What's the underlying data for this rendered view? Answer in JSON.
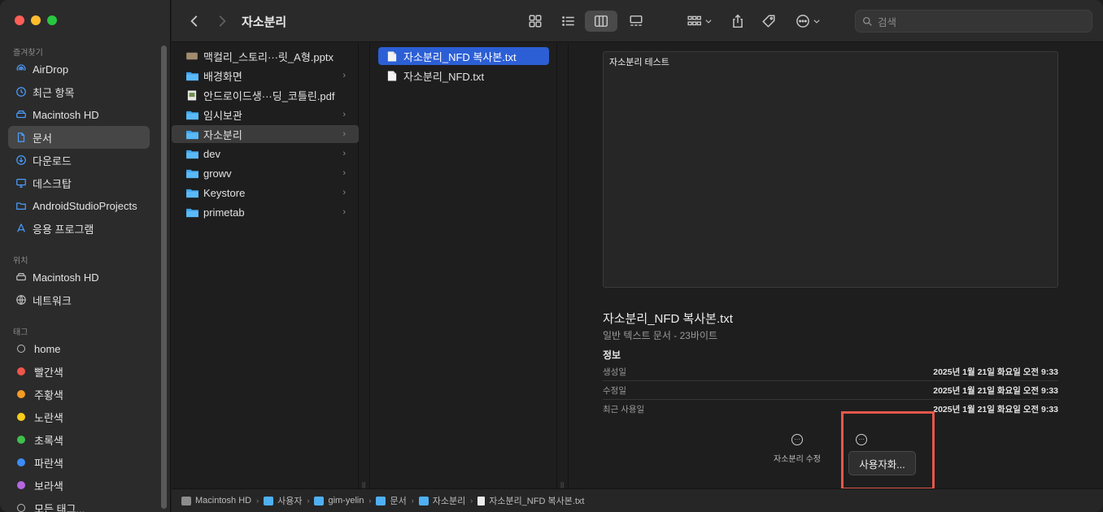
{
  "toolbar": {
    "title": "자소분리",
    "search_placeholder": "검색"
  },
  "sidebar": {
    "favorites_header": "즐겨찾기",
    "favorites": [
      {
        "label": "AirDrop",
        "icon": "airdrop-icon"
      },
      {
        "label": "최근 항목",
        "icon": "clock-icon"
      },
      {
        "label": "Macintosh HD",
        "icon": "hard-drive-icon"
      },
      {
        "label": "문서",
        "icon": "document-icon",
        "selected": true
      },
      {
        "label": "다운로드",
        "icon": "download-icon"
      },
      {
        "label": "데스크탑",
        "icon": "desktop-icon"
      },
      {
        "label": "AndroidStudioProjects",
        "icon": "folder-icon"
      },
      {
        "label": "응용 프로그램",
        "icon": "applications-icon"
      }
    ],
    "locations_header": "위치",
    "locations": [
      {
        "label": "Macintosh HD",
        "icon": "hard-drive-icon"
      },
      {
        "label": "네트워크",
        "icon": "network-icon"
      }
    ],
    "tags_header": "태그",
    "tags": [
      {
        "label": "home",
        "color": "none"
      },
      {
        "label": "빨간색",
        "color": "#f0564b"
      },
      {
        "label": "주황색",
        "color": "#f59b23"
      },
      {
        "label": "노란색",
        "color": "#f6cd1b"
      },
      {
        "label": "초록색",
        "color": "#3fc04b"
      },
      {
        "label": "파란색",
        "color": "#3b8df5"
      },
      {
        "label": "보라색",
        "color": "#b567e0"
      },
      {
        "label": "모든 태그...",
        "color": "none"
      }
    ]
  },
  "column1": [
    {
      "name": "맥컬리_스토리···릿_A형.pptx",
      "type": "pptx",
      "has_children": false
    },
    {
      "name": "배경화면",
      "type": "folder",
      "has_children": true
    },
    {
      "name": "안드로이드생···딩_코틀린.pdf",
      "type": "pdf",
      "has_children": false
    },
    {
      "name": "임시보관",
      "type": "folder",
      "has_children": true
    },
    {
      "name": "자소분리",
      "type": "folder",
      "has_children": true,
      "selected": true
    },
    {
      "name": "dev",
      "type": "folder",
      "has_children": true
    },
    {
      "name": "growv",
      "type": "folder",
      "has_children": true
    },
    {
      "name": "Keystore",
      "type": "folder",
      "has_children": true
    },
    {
      "name": "primetab",
      "type": "folder",
      "has_children": true
    }
  ],
  "column2": [
    {
      "name": "자소분리_NFD 복사본.txt",
      "selected": true
    },
    {
      "name": "자소분리_NFD.txt"
    }
  ],
  "preview": {
    "content": "자소분리 테스트",
    "filename": "자소분리_NFD 복사본.txt",
    "kind": "일반 텍스트 문서 - 23바이트",
    "info_header": "정보",
    "meta": [
      {
        "key": "생성일",
        "value": "2025년 1월 21일 화요일 오전 9:33"
      },
      {
        "key": "수정일",
        "value": "2025년 1월 21일 화요일 오전 9:33"
      },
      {
        "key": "최근 사용일",
        "value": "2025년 1월 21일 화요일 오전 9:33"
      }
    ],
    "action_label": "자소분리 수정",
    "customize_label": "사용자화..."
  },
  "pathbar": [
    {
      "label": "Macintosh HD",
      "icon": "hard-drive-icon"
    },
    {
      "label": "사용자",
      "icon": "folder-icon"
    },
    {
      "label": "gim-yelin",
      "icon": "home-folder-icon"
    },
    {
      "label": "문서",
      "icon": "folder-icon"
    },
    {
      "label": "자소분리",
      "icon": "folder-icon"
    },
    {
      "label": "자소분리_NFD 복사본.txt",
      "icon": "text-file-icon"
    }
  ]
}
